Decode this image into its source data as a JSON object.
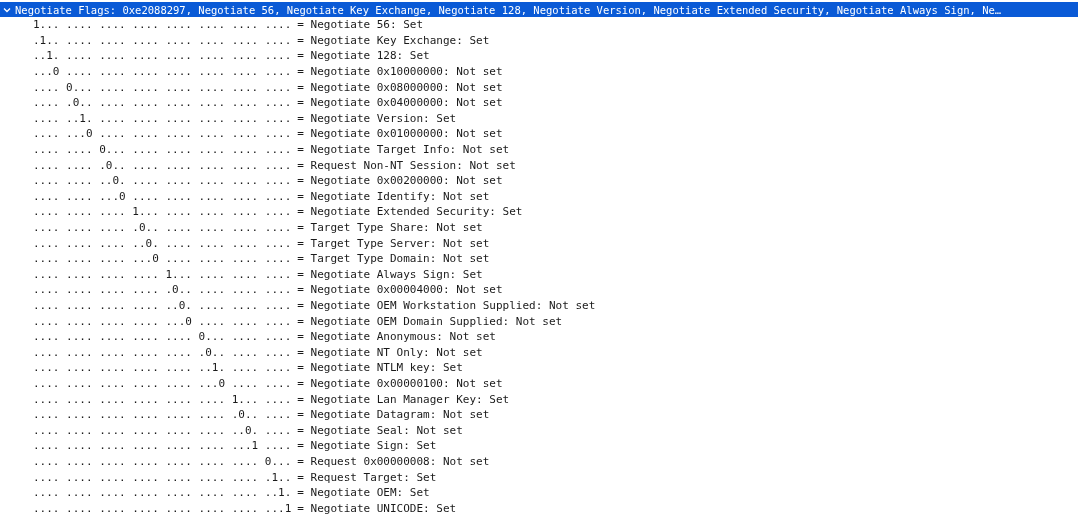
{
  "header": {
    "text": "Negotiate Flags: 0xe2088297, Negotiate 56, Negotiate Key Exchange, Negotiate 128, Negotiate Version, Negotiate Extended Security, Negotiate Always Sign, Ne…",
    "selected": true,
    "expanded": true
  },
  "rows": [
    {
      "bits": "1... .... .... .... .... .... .... ....",
      "desc": "= Negotiate 56: Set"
    },
    {
      "bits": ".1.. .... .... .... .... .... .... ....",
      "desc": "= Negotiate Key Exchange: Set"
    },
    {
      "bits": "..1. .... .... .... .... .... .... ....",
      "desc": "= Negotiate 128: Set"
    },
    {
      "bits": "...0 .... .... .... .... .... .... ....",
      "desc": "= Negotiate 0x10000000: Not set"
    },
    {
      "bits": ".... 0... .... .... .... .... .... ....",
      "desc": "= Negotiate 0x08000000: Not set"
    },
    {
      "bits": ".... .0.. .... .... .... .... .... ....",
      "desc": "= Negotiate 0x04000000: Not set"
    },
    {
      "bits": ".... ..1. .... .... .... .... .... ....",
      "desc": "= Negotiate Version: Set"
    },
    {
      "bits": ".... ...0 .... .... .... .... .... ....",
      "desc": "= Negotiate 0x01000000: Not set"
    },
    {
      "bits": ".... .... 0... .... .... .... .... ....",
      "desc": "= Negotiate Target Info: Not set"
    },
    {
      "bits": ".... .... .0.. .... .... .... .... ....",
      "desc": "= Request Non-NT Session: Not set"
    },
    {
      "bits": ".... .... ..0. .... .... .... .... ....",
      "desc": "= Negotiate 0x00200000: Not set"
    },
    {
      "bits": ".... .... ...0 .... .... .... .... ....",
      "desc": "= Negotiate Identify: Not set"
    },
    {
      "bits": ".... .... .... 1... .... .... .... ....",
      "desc": "= Negotiate Extended Security: Set"
    },
    {
      "bits": ".... .... .... .0.. .... .... .... ....",
      "desc": "= Target Type Share: Not set"
    },
    {
      "bits": ".... .... .... ..0. .... .... .... ....",
      "desc": "= Target Type Server: Not set"
    },
    {
      "bits": ".... .... .... ...0 .... .... .... ....",
      "desc": "= Target Type Domain: Not set"
    },
    {
      "bits": ".... .... .... .... 1... .... .... ....",
      "desc": "= Negotiate Always Sign: Set"
    },
    {
      "bits": ".... .... .... .... .0.. .... .... ....",
      "desc": "= Negotiate 0x00004000: Not set"
    },
    {
      "bits": ".... .... .... .... ..0. .... .... ....",
      "desc": "= Negotiate OEM Workstation Supplied: Not set"
    },
    {
      "bits": ".... .... .... .... ...0 .... .... ....",
      "desc": "= Negotiate OEM Domain Supplied: Not set"
    },
    {
      "bits": ".... .... .... .... .... 0... .... ....",
      "desc": "= Negotiate Anonymous: Not set"
    },
    {
      "bits": ".... .... .... .... .... .0.. .... ....",
      "desc": "= Negotiate NT Only: Not set"
    },
    {
      "bits": ".... .... .... .... .... ..1. .... ....",
      "desc": "= Negotiate NTLM key: Set"
    },
    {
      "bits": ".... .... .... .... .... ...0 .... ....",
      "desc": "= Negotiate 0x00000100: Not set"
    },
    {
      "bits": ".... .... .... .... .... .... 1... ....",
      "desc": "= Negotiate Lan Manager Key: Set"
    },
    {
      "bits": ".... .... .... .... .... .... .0.. ....",
      "desc": "= Negotiate Datagram: Not set"
    },
    {
      "bits": ".... .... .... .... .... .... ..0. ....",
      "desc": "= Negotiate Seal: Not set"
    },
    {
      "bits": ".... .... .... .... .... .... ...1 ....",
      "desc": "= Negotiate Sign: Set"
    },
    {
      "bits": ".... .... .... .... .... .... .... 0...",
      "desc": "= Request 0x00000008: Not set"
    },
    {
      "bits": ".... .... .... .... .... .... .... .1..",
      "desc": "= Request Target: Set"
    },
    {
      "bits": ".... .... .... .... .... .... .... ..1.",
      "desc": "= Negotiate OEM: Set"
    },
    {
      "bits": ".... .... .... .... .... .... .... ...1",
      "desc": "= Negotiate UNICODE: Set"
    }
  ]
}
